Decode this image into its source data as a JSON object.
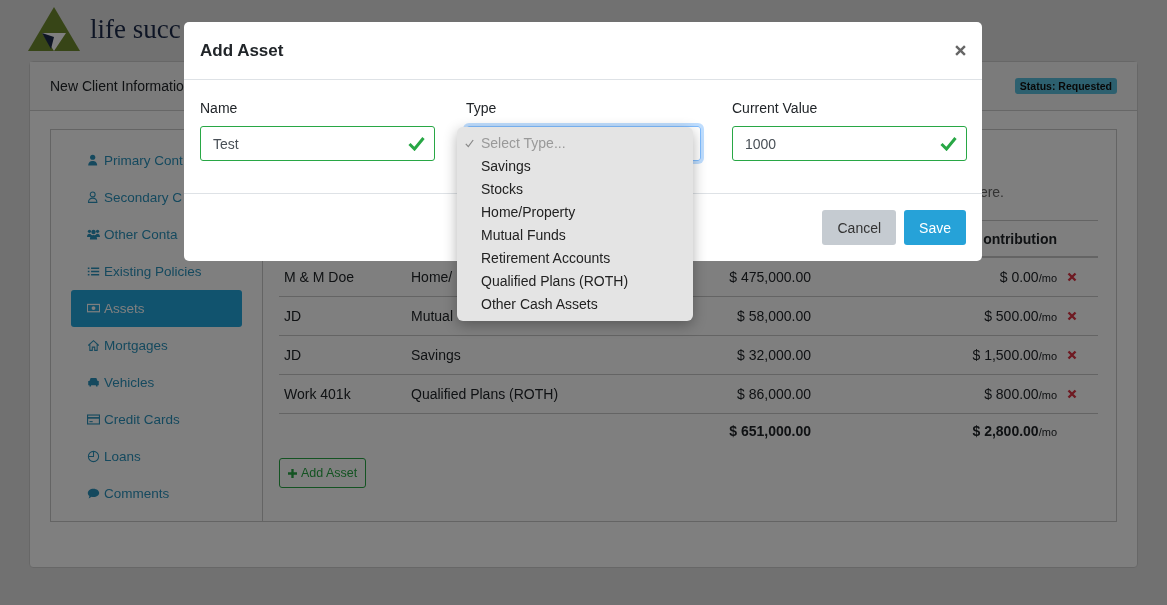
{
  "background": {
    "logo_text": "life succ",
    "card_title": "New Client Informatio",
    "status_badge": "Status: Requested",
    "sidebar": [
      {
        "label": "Primary Cont",
        "kind": "user",
        "selected": false
      },
      {
        "label": "Secondary C",
        "kind": "contact",
        "selected": false
      },
      {
        "label": "Other Conta",
        "kind": "group",
        "selected": false
      },
      {
        "label": "Existing Policies",
        "kind": "list",
        "selected": false
      },
      {
        "label": "Assets",
        "kind": "money",
        "selected": true
      },
      {
        "label": "Mortgages",
        "kind": "home",
        "selected": false
      },
      {
        "label": "Vehicles",
        "kind": "car",
        "selected": false
      },
      {
        "label": "Credit Cards",
        "kind": "card",
        "selected": false
      },
      {
        "label": "Loans",
        "kind": "clock",
        "selected": false
      },
      {
        "label": "Comments",
        "kind": "comment",
        "selected": false
      }
    ],
    "note": "ere.",
    "table": {
      "header": {
        "column_4": "ontribution"
      },
      "rows": [
        {
          "name": "M & M Doe",
          "type": "Home/",
          "value": "$ 475,000.00",
          "contribution": "$ 0.00",
          "unit": "/mo"
        },
        {
          "name": "JD",
          "type": "Mutual",
          "value": "$ 58,000.00",
          "contribution": "$ 500.00",
          "unit": "/mo"
        },
        {
          "name": "JD",
          "type": "Savings",
          "value": "$ 32,000.00",
          "contribution": "$ 1,500.00",
          "unit": "/mo"
        },
        {
          "name": "Work 401k",
          "type": "Qualified Plans (ROTH)",
          "value": "$ 86,000.00",
          "contribution": "$ 800.00",
          "unit": "/mo"
        }
      ],
      "totals": {
        "value": "$ 651,000.00",
        "contribution": "$ 2,800.00",
        "unit": "/mo"
      }
    },
    "add_button": "Add Asset"
  },
  "modal": {
    "title": "Add Asset",
    "fields": [
      {
        "label": "Name",
        "kind": "text",
        "value": "Test",
        "valid": true
      },
      {
        "label": "Type",
        "kind": "select",
        "focused": true
      },
      {
        "label": "Current Value",
        "kind": "text",
        "value": "1000",
        "valid": true
      }
    ],
    "dropdown": {
      "options": [
        {
          "label": "Select Type...",
          "selected": true,
          "disabled": true
        },
        {
          "label": "Savings",
          "selected": false,
          "disabled": false
        },
        {
          "label": "Stocks",
          "selected": false,
          "disabled": false
        },
        {
          "label": "Home/Property",
          "selected": false,
          "disabled": false
        },
        {
          "label": "Mutual Funds",
          "selected": false,
          "disabled": false
        },
        {
          "label": "Retirement Accounts",
          "selected": false,
          "disabled": false
        },
        {
          "label": "Qualified Plans (ROTH)",
          "selected": false,
          "disabled": false
        },
        {
          "label": "Other Cash Assets",
          "selected": false,
          "disabled": false
        }
      ]
    },
    "buttons": [
      {
        "label": "Cancel",
        "kind": "secondary"
      },
      {
        "label": "Save",
        "kind": "primary"
      }
    ]
  }
}
